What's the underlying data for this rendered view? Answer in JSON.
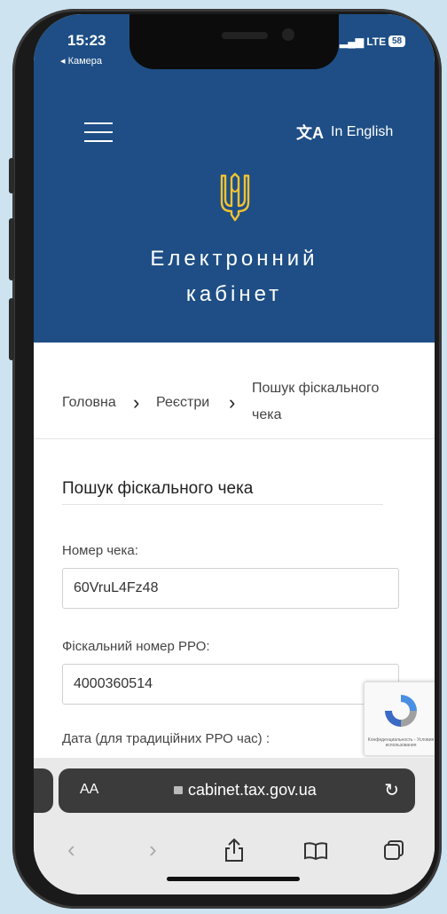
{
  "status": {
    "time": "15:23",
    "back_label": "◂ Камера",
    "network": "LTE",
    "battery": "58"
  },
  "header": {
    "language_label": "In English",
    "title_line1": "Електронний",
    "title_line2": "кабінет",
    "brand_color": "#1e4e85",
    "emblem_color": "#f2c230"
  },
  "breadcrumb": {
    "home": "Головна",
    "registers": "Реєстри",
    "current_line1": "Пошук фіскального",
    "current_line2": "чека"
  },
  "form": {
    "title": "Пошук фіскального чека",
    "receipt_label": "Номер чека:",
    "receipt_value": "60VruL4Fz48",
    "fiscal_label": "Фіскальний номер РРО:",
    "fiscal_value": "4000360514",
    "date_label": "Дата (для традиційних РРО час) :"
  },
  "recaptcha": {
    "text": "Конфиденциальность - Условия использования"
  },
  "browser": {
    "text_size": "AA",
    "url": "cabinet.tax.gov.ua"
  }
}
